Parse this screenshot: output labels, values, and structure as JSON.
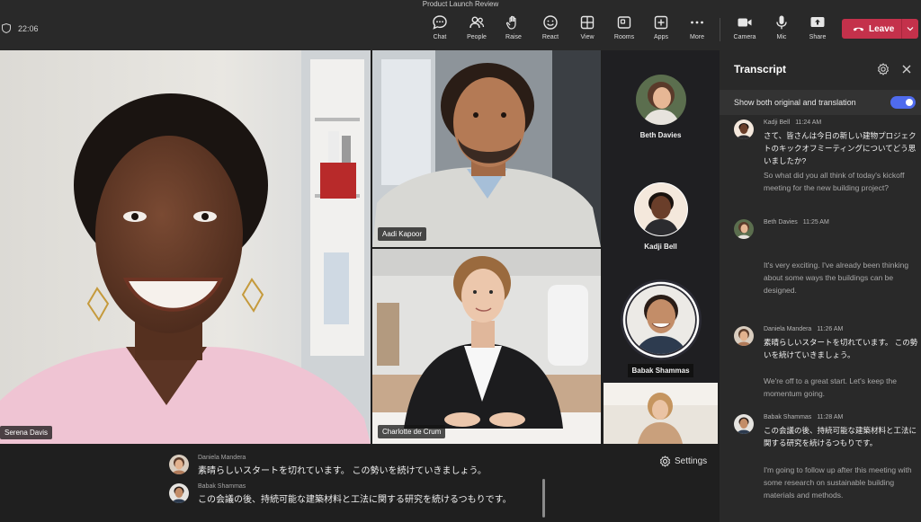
{
  "meeting": {
    "title": "Product Launch Review",
    "elapsed": "22:06"
  },
  "toolbar": {
    "items": [
      {
        "label": "Chat",
        "icon": "chat-icon"
      },
      {
        "label": "People",
        "icon": "people-icon"
      },
      {
        "label": "Raise",
        "icon": "raise-hand-icon"
      },
      {
        "label": "React",
        "icon": "react-icon"
      },
      {
        "label": "View",
        "icon": "view-icon"
      },
      {
        "label": "Rooms",
        "icon": "rooms-icon"
      },
      {
        "label": "Apps",
        "icon": "apps-icon"
      },
      {
        "label": "More",
        "icon": "more-icon"
      },
      {
        "label": "Camera",
        "icon": "camera-icon"
      },
      {
        "label": "Mic",
        "icon": "mic-icon"
      },
      {
        "label": "Share",
        "icon": "share-icon"
      }
    ],
    "leave_label": "Leave",
    "leave_color": "#c4314b"
  },
  "stage": {
    "participants": [
      {
        "name": "Serena Davis"
      },
      {
        "name": "Aadi Kapoor"
      },
      {
        "name": "Charlotte de Crum"
      }
    ]
  },
  "roster": [
    {
      "name": "Beth Davies"
    },
    {
      "name": "Kadji Bell"
    },
    {
      "name": "Babak Shammas"
    }
  ],
  "captions": {
    "settings_label": "Settings",
    "lines": [
      {
        "speaker": "Daniela Mandera",
        "text": "素晴らしいスタートを切れています。 この勢いを続けていきましょう。"
      },
      {
        "speaker": "Babak Shammas",
        "text": "この会議の後、持続可能な建築材料と工法に関する研究を続けるつもりです。"
      }
    ]
  },
  "transcript": {
    "title": "Transcript",
    "toggle_label": "Show both original and translation",
    "toggle_on": true,
    "accent_color": "#4f6bed",
    "entries": [
      {
        "speaker": "Kadji Bell",
        "time": "11:24 AM",
        "original": "さて、皆さんは今日の新しい建物プロジェクトのキックオフミーティングについてどう思いましたか?",
        "translation": "So what did you all think of today's kickoff meeting for the new building project?"
      },
      {
        "speaker": "Beth Davies",
        "time": "11:25 AM",
        "original": "",
        "translation": "It's very exciting. I've already been thinking about some ways the buildings can be designed."
      },
      {
        "speaker": "Daniela Mandera",
        "time": "11:26 AM",
        "original": "素晴らしいスタートを切れています。 この勢いを続けていきましょう。",
        "translation": "We're off to a great start. Let's keep the momentum going."
      },
      {
        "speaker": "Babak Shammas",
        "time": "11:28 AM",
        "original": "この会議の後、持続可能な建築材料と工法に関する研究を続けるつもりです。",
        "translation": "I'm going to follow up after this meeting with some research on sustainable building materials and methods."
      }
    ]
  }
}
